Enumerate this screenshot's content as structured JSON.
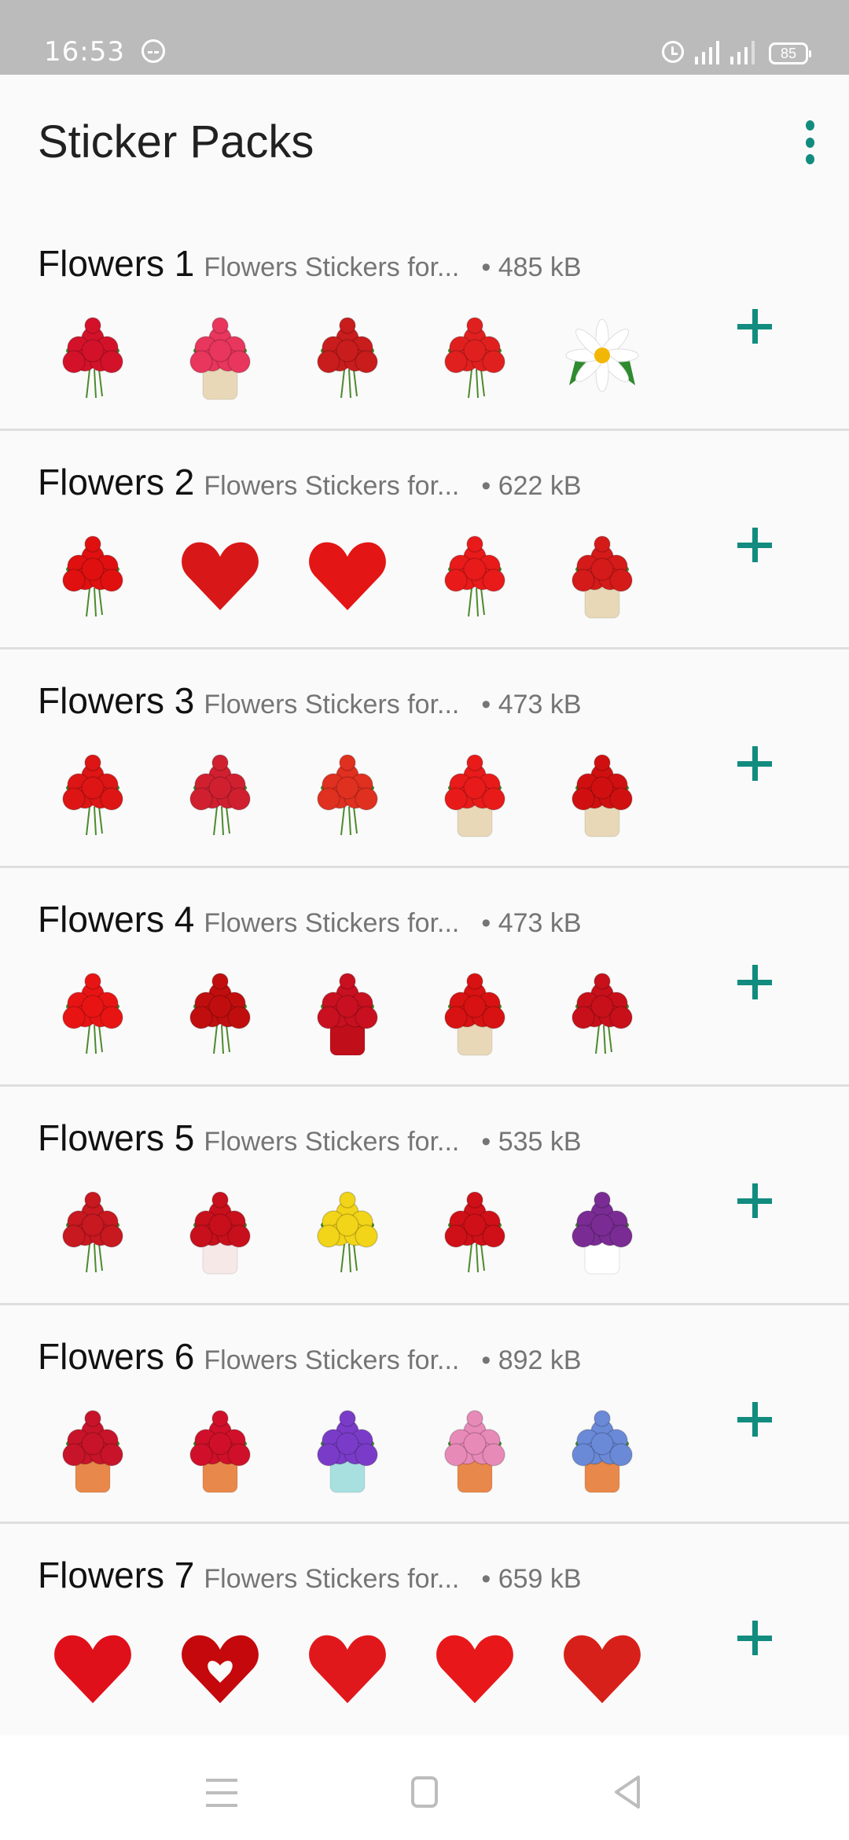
{
  "status_bar": {
    "time": "16:53",
    "battery": "85",
    "icons": [
      "devil-face-icon",
      "alarm-icon",
      "signal-icon",
      "signal-icon",
      "battery-icon"
    ]
  },
  "header": {
    "title": "Sticker Packs",
    "menu_icon": "more-vertical-icon"
  },
  "packs": [
    {
      "name": "Flowers 1",
      "publisher": "Flowers Stickers for...",
      "size": "• 485 kB",
      "stickers": [
        "pink-red-rose-bunch",
        "mixed-rose-vase",
        "red-rose-bouquet",
        "red-rose-ribbon-bouquet",
        "white-daisy"
      ]
    },
    {
      "name": "Flowers 2",
      "publisher": "Flowers Stickers for...",
      "size": "• 622 kB",
      "stickers": [
        "rose-basket",
        "rose-heart-leaves",
        "rose-heart",
        "rose-bouquet-ribbon",
        "roses-in-glass-vase"
      ]
    },
    {
      "name": "Flowers 3",
      "publisher": "Flowers Stickers for...",
      "size": "• 473 kB",
      "stickers": [
        "rose-small-basket",
        "red-lilies-vase",
        "red-tulips-bulbs",
        "rose-basket-bow",
        "roses-glass-vase"
      ]
    },
    {
      "name": "Flowers 4",
      "publisher": "Flowers Stickers for...",
      "size": "• 473 kB",
      "stickers": [
        "round-rose-bouquet",
        "dense-rose-bouquet",
        "roses-red-vase",
        "roses-glass-jar",
        "rose-cluster"
      ]
    },
    {
      "name": "Flowers 5",
      "publisher": "Flowers Stickers for...",
      "size": "• 535 kB",
      "stickers": [
        "pink-red-rose-heart",
        "roses-hat-box",
        "yellow-rose-bouquet",
        "red-white-rose-bouquet",
        "purple-flowers-pot"
      ]
    },
    {
      "name": "Flowers 6",
      "publisher": "Flowers Stickers for...",
      "size": "• 892 kB",
      "stickers": [
        "red-flower-box",
        "red-rose-box",
        "purple-flower-box",
        "pink-flower-box",
        "blue-hydrangea-box"
      ]
    },
    {
      "name": "Flowers 7",
      "publisher": "Flowers Stickers for...",
      "size": "• 659 kB",
      "stickers": [
        "rose-petal-heart",
        "rose-wreath-heart",
        "petal-heart",
        "rose-shaped-heart",
        "rose-cluster-heart"
      ]
    }
  ],
  "add_icon": "plus-icon",
  "nav_bar": {
    "buttons": [
      "menu-icon",
      "home-icon",
      "back-icon"
    ]
  },
  "colors": {
    "accent": "#128c7e",
    "status_bar": "#bbbbbb",
    "background": "#fafafa",
    "divider": "#dedede"
  }
}
